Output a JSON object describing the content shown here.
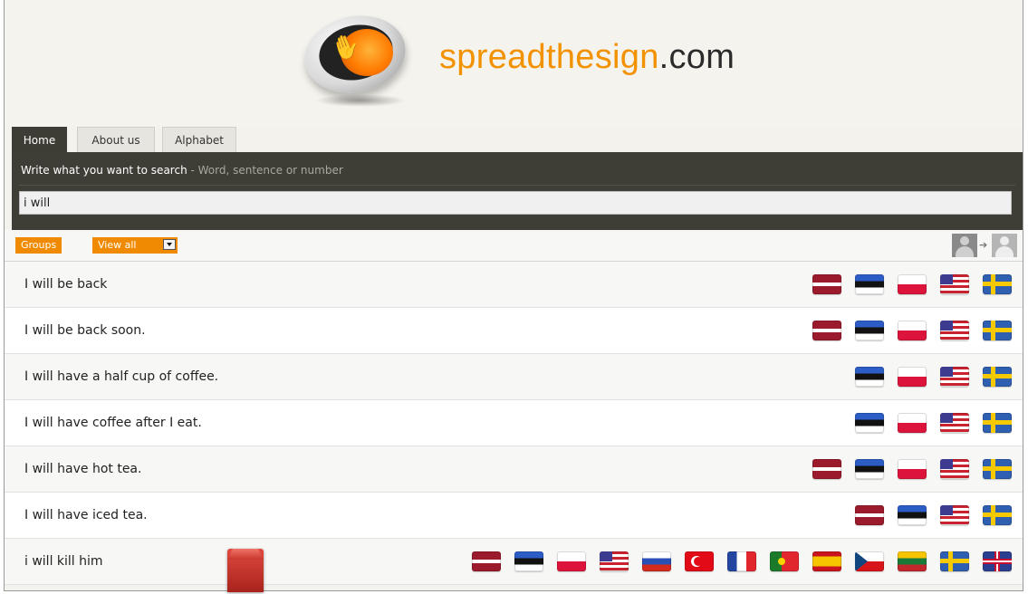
{
  "site": {
    "title_main": "spreadthesign",
    "title_domain": ".com"
  },
  "tabs": [
    {
      "label": "Home",
      "active": true
    },
    {
      "label": "About us",
      "active": false
    },
    {
      "label": "Alphabet",
      "active": false
    }
  ],
  "search": {
    "label": "Write what you want to search",
    "hint": " - Word, sentence or number",
    "value": "i will"
  },
  "toolbar": {
    "groups_label": "Groups",
    "viewall_label": "View all",
    "icons": [
      "person-icon",
      "arrow-right-icon",
      "person-icon"
    ]
  },
  "results": [
    {
      "text": "I will be back",
      "flags": [
        "lv",
        "ee",
        "pl",
        "us",
        "se"
      ]
    },
    {
      "text": "I will be back soon.",
      "flags": [
        "lv",
        "ee",
        "pl",
        "us",
        "se"
      ]
    },
    {
      "text": "I will have a half cup of coffee.",
      "flags": [
        "ee",
        "pl",
        "us",
        "se"
      ]
    },
    {
      "text": "I will have coffee after I eat.",
      "flags": [
        "ee",
        "pl",
        "us",
        "se"
      ]
    },
    {
      "text": "I will have hot tea.",
      "flags": [
        "lv",
        "ee",
        "pl",
        "us",
        "se"
      ]
    },
    {
      "text": "I will have iced tea.",
      "flags": [
        "lv",
        "ee",
        "us",
        "se"
      ]
    },
    {
      "text": "i will kill him",
      "flags": [
        "lv",
        "ee",
        "pl",
        "us",
        "ru",
        "tr",
        "fr",
        "pt",
        "es",
        "cz",
        "lt",
        "se",
        "gb"
      ]
    }
  ],
  "colors": {
    "brand_orange": "#f39200",
    "dark_bar": "#3f3e36",
    "button_orange": "#f08a00"
  }
}
